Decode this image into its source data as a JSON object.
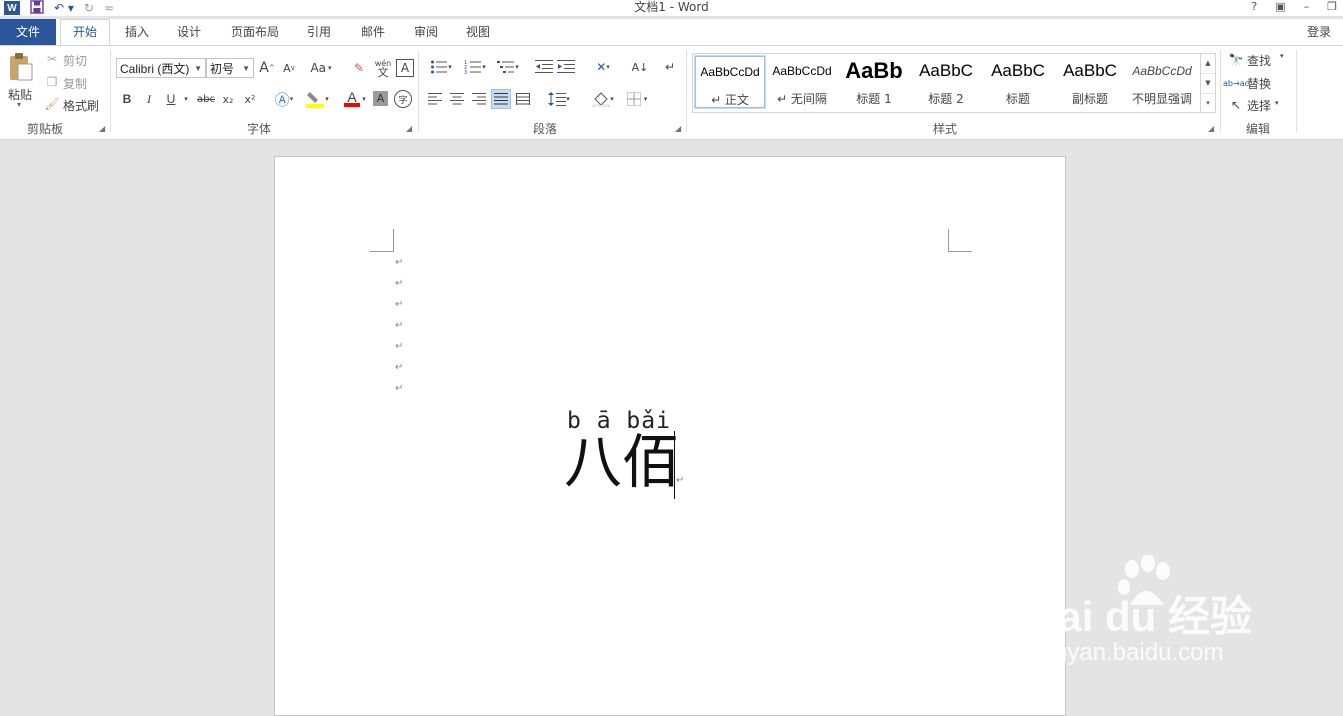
{
  "app": {
    "title": "文档1 - Word",
    "logo_letter": "W",
    "window_controls": [
      "?",
      "▣",
      "–",
      "❐"
    ]
  },
  "tabs": {
    "file": "文件",
    "items": [
      "开始",
      "插入",
      "设计",
      "页面布局",
      "引用",
      "邮件",
      "审阅",
      "视图"
    ],
    "active": "开始",
    "login": "登录"
  },
  "clipboard": {
    "paste": "粘贴",
    "cut": "剪切",
    "copy": "复制",
    "format_painter": "格式刷",
    "group_label": "剪贴板"
  },
  "font": {
    "font_name": "Calibri (西文)",
    "font_size": "初号",
    "group_label": "字体",
    "change_case": "Aa",
    "phonetic_guide_top": "wén",
    "phonetic_guide_bottom": "文",
    "bold": "B",
    "italic": "I",
    "underline": "U",
    "strikethrough": "abc",
    "subscript": "x₂",
    "superscript": "x²",
    "enclose_char": "字",
    "char_border": "A",
    "char_shading": "A",
    "grow_font": "A",
    "shrink_font": "A"
  },
  "paragraph": {
    "group_label": "段落"
  },
  "styles": {
    "group_label": "样式",
    "items": [
      {
        "preview": "AaBbCcDd",
        "name": "↵ 正文"
      },
      {
        "preview": "AaBbCcDd",
        "name": "↵ 无间隔"
      },
      {
        "preview": "AaBb",
        "name": "标题 1"
      },
      {
        "preview": "AaBbC",
        "name": "标题 2"
      },
      {
        "preview": "AaBbC",
        "name": "标题"
      },
      {
        "preview": "AaBbC",
        "name": "副标题"
      },
      {
        "preview": "AaBbCcDd",
        "name": "不明显强调"
      }
    ]
  },
  "editing": {
    "group_label": "编辑",
    "find": "查找",
    "replace": "替换",
    "select": "选择"
  },
  "document": {
    "paragraph_mark": "↵",
    "pinyin": "b ā bǎi",
    "text": "八佰"
  },
  "watermark": {
    "brand": "Bai du 经验",
    "url": "jingyan.baidu.com"
  },
  "colors": {
    "word_blue": "#2b579a",
    "highlight_yellow": "#ffff00",
    "font_red": "#ff0000"
  }
}
